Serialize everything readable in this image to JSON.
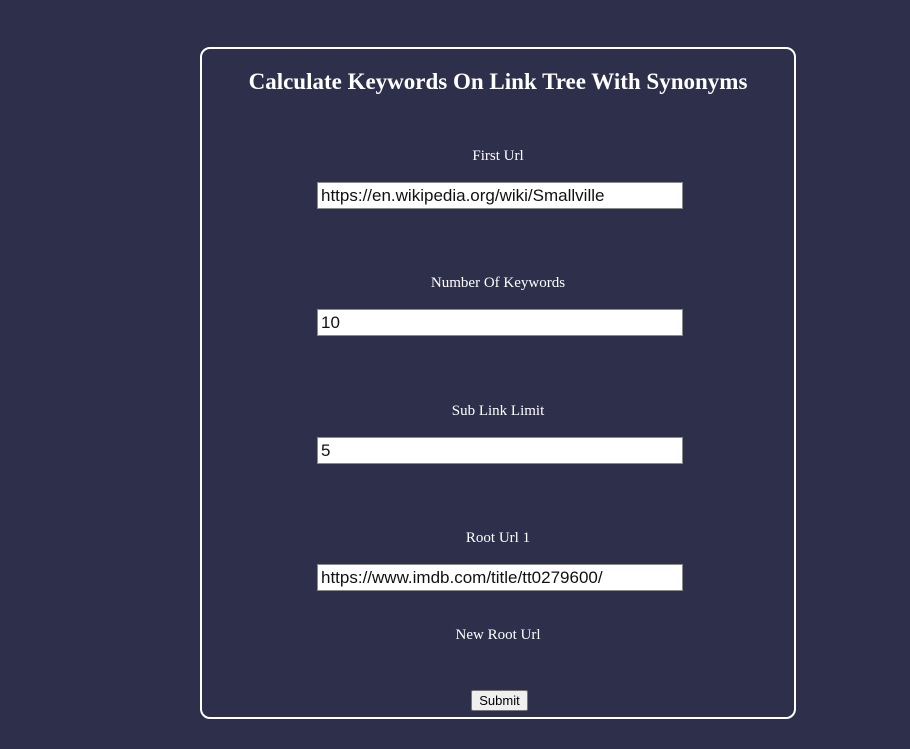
{
  "form": {
    "title": "Calculate Keywords On Link Tree With Synonyms",
    "first_url": {
      "label": "First Url",
      "value": "https://en.wikipedia.org/wiki/Smallville"
    },
    "number_of_keywords": {
      "label": "Number Of Keywords",
      "value": "10"
    },
    "sub_link_limit": {
      "label": "Sub Link Limit",
      "value": "5"
    },
    "root_url_1": {
      "label": "Root Url 1",
      "value": "https://www.imdb.com/title/tt0279600/"
    },
    "new_root_url_label": "New Root Url",
    "submit_label": "Submit"
  },
  "colors": {
    "background": "#2d2f4b",
    "text": "#ffffff",
    "panel_border": "#ffffff"
  }
}
